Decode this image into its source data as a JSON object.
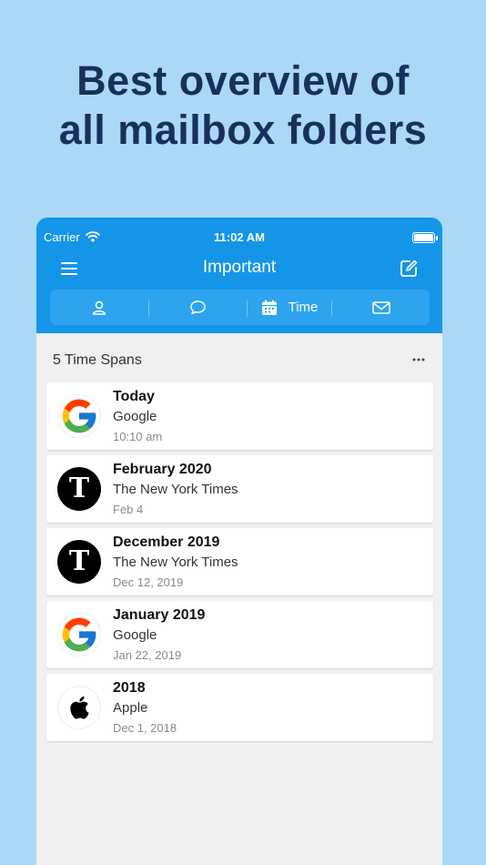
{
  "headline": {
    "line1": "Best overview of",
    "line2": "all mailbox folders"
  },
  "status_bar": {
    "carrier": "Carrier",
    "time": "11:02 AM",
    "battery_level": 1.0
  },
  "nav": {
    "title": "Important",
    "menu_icon": "hamburger-menu-icon",
    "compose_icon": "compose-icon"
  },
  "segments": [
    {
      "icon": "person-icon",
      "label": ""
    },
    {
      "icon": "chat-bubble-icon",
      "label": ""
    },
    {
      "icon": "calendar-icon",
      "label": "Time"
    },
    {
      "icon": "envelope-icon",
      "label": ""
    }
  ],
  "section": {
    "title": "5 Time Spans",
    "more_icon": "ellipsis-icon"
  },
  "items": [
    {
      "title": "Today",
      "sender": "Google",
      "date": "10:10 am",
      "logo": "google-logo"
    },
    {
      "title": "February 2020",
      "sender": "The New York Times",
      "date": "Feb 4",
      "logo": "nyt-logo"
    },
    {
      "title": "December 2019",
      "sender": "The New York Times",
      "date": "Dec 12, 2019",
      "logo": "nyt-logo"
    },
    {
      "title": "January 2019",
      "sender": "Google",
      "date": "Jan 22, 2019",
      "logo": "google-logo"
    },
    {
      "title": "2018",
      "sender": "Apple",
      "date": "Dec 1, 2018",
      "logo": "apple-logo"
    }
  ],
  "colors": {
    "background": "#ABD8F6",
    "headline": "#17305C",
    "topbar": "#1495E8",
    "segment_bg": "#2EA4EF",
    "list_bg": "#F0F0F2"
  }
}
